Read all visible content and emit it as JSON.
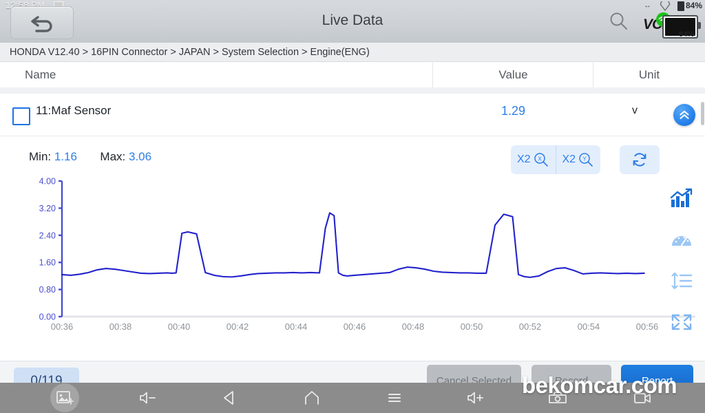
{
  "statusbar": {
    "clock": "12:58 PM",
    "screenshot_icon": "screenshot-icon",
    "bluetooth_icon": "bluetooth-icon",
    "location_icon": "location-icon",
    "battery_percent_top": "84%",
    "battery_percent": "84%",
    "vci_label": "VCI",
    "wifi_icon": "wifi-icon",
    "search_icon": "search-icon",
    "back_icon": "back-arrow-icon"
  },
  "header": {
    "title": "Live Data"
  },
  "breadcrumb": {
    "text": "HONDA V12.40 > 16PIN Connector  > JAPAN  > System Selection  > Engine(ENG)"
  },
  "table": {
    "columns": {
      "name": "Name",
      "value": "Value",
      "unit": "Unit"
    },
    "rows": [
      {
        "checked": false,
        "name": "11:Maf Sensor",
        "value": "1.29",
        "unit": "v"
      }
    ],
    "collapse_icon": "chevron-double-up-icon"
  },
  "stats": {
    "min_label": "Min:",
    "min_value": "1.16",
    "max_label": "Max:",
    "max_value": "3.06"
  },
  "zoom_controls": {
    "x_zoom_label": "X2",
    "x_zoom_icon": "magnifier-x-icon",
    "y_zoom_label": "X2",
    "y_zoom_icon": "magnifier-y-icon",
    "refresh_icon": "refresh-icon"
  },
  "rail": {
    "items": [
      {
        "icon": "chart-graph-icon",
        "active": true
      },
      {
        "icon": "gauge-dial-icon",
        "active": false
      },
      {
        "icon": "list-height-icon",
        "active": false
      },
      {
        "icon": "fullscreen-expand-icon",
        "active": false
      }
    ]
  },
  "bottombar": {
    "counter": "0/119",
    "cancel_selected_label": "Cancel Selected",
    "middle_label": "Record",
    "primary_label": "Report"
  },
  "navbar": {
    "screenshot_icon": "screenshot-icon",
    "volume_down_icon": "volume-down-icon",
    "back_icon": "back-triangle-icon",
    "home_icon": "home-icon",
    "recents_icon": "menu-lines-icon",
    "volume_up_icon": "volume-up-icon",
    "camera_icon": "camera-icon",
    "record_icon": "record-video-icon"
  },
  "watermark": {
    "text": "bekomcar.com"
  },
  "colors": {
    "accent_blue": "#2f7ee8",
    "plot_line": "#2222cc",
    "axis_blue": "#4a4fd0",
    "tick_gray": "#8d9298",
    "nav_gray": "#8c8c8c"
  },
  "chart_data": {
    "type": "line",
    "title": "",
    "xlabel": "",
    "ylabel": "",
    "series_name": "11:Maf Sensor",
    "unit": "v",
    "ylim": [
      0.0,
      4.0
    ],
    "yticks": [
      "0.00",
      "0.80",
      "1.60",
      "2.40",
      "3.20",
      "4.00"
    ],
    "ytick_values": [
      0.0,
      0.8,
      1.6,
      2.4,
      3.2,
      4.0
    ],
    "xlim": [
      36,
      56
    ],
    "xticks": [
      "00:36",
      "00:38",
      "00:40",
      "00:42",
      "00:44",
      "00:46",
      "00:48",
      "00:50",
      "00:52",
      "00:54",
      "00:56"
    ],
    "xtick_values": [
      36,
      38,
      40,
      42,
      44,
      46,
      48,
      50,
      52,
      54,
      56
    ],
    "grid": false,
    "legend": "none",
    "min": 1.16,
    "max": 3.06,
    "current": 1.29,
    "x": [
      36.0,
      36.3,
      36.6,
      36.9,
      37.2,
      37.5,
      37.8,
      38.1,
      38.4,
      38.7,
      39.0,
      39.3,
      39.6,
      39.75,
      39.9,
      40.1,
      40.3,
      40.6,
      40.9,
      41.2,
      41.5,
      41.8,
      42.1,
      42.4,
      42.7,
      43.0,
      43.3,
      43.6,
      43.9,
      44.2,
      44.5,
      44.8,
      45.0,
      45.15,
      45.3,
      45.45,
      45.6,
      45.75,
      46.0,
      46.3,
      46.6,
      46.9,
      47.2,
      47.5,
      47.8,
      48.1,
      48.4,
      48.7,
      49.0,
      49.3,
      49.6,
      49.9,
      50.2,
      50.5,
      50.8,
      51.1,
      51.4,
      51.6,
      51.8,
      52.0,
      52.3,
      52.6,
      52.9,
      53.2,
      53.5,
      53.8,
      54.1,
      54.4,
      54.7,
      55.0,
      55.3,
      55.6,
      55.9
    ],
    "y": [
      1.24,
      1.22,
      1.25,
      1.3,
      1.38,
      1.42,
      1.4,
      1.36,
      1.32,
      1.28,
      1.27,
      1.28,
      1.29,
      1.28,
      1.29,
      2.46,
      2.5,
      2.44,
      1.3,
      1.22,
      1.18,
      1.17,
      1.2,
      1.24,
      1.27,
      1.28,
      1.29,
      1.29,
      1.3,
      1.29,
      1.3,
      1.29,
      2.6,
      3.06,
      2.98,
      1.29,
      1.22,
      1.2,
      1.22,
      1.24,
      1.26,
      1.28,
      1.3,
      1.4,
      1.46,
      1.44,
      1.4,
      1.34,
      1.31,
      1.3,
      1.29,
      1.29,
      1.28,
      1.28,
      2.7,
      3.02,
      2.95,
      1.24,
      1.18,
      1.16,
      1.2,
      1.33,
      1.42,
      1.44,
      1.36,
      1.26,
      1.28,
      1.29,
      1.28,
      1.27,
      1.28,
      1.27,
      1.28
    ]
  }
}
